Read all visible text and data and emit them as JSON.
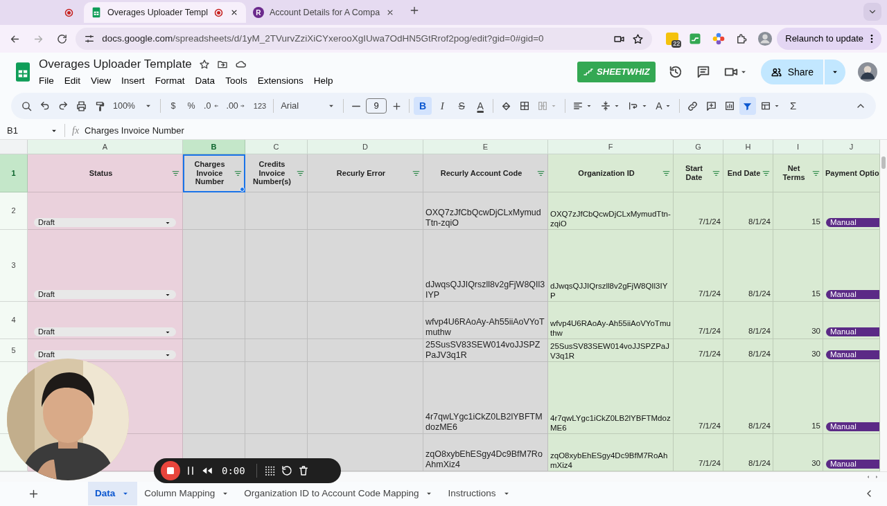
{
  "browser": {
    "tabs": [
      {
        "kind": "pinned",
        "recording": true,
        "selected": false
      },
      {
        "kind": "sheets",
        "title": "Overages Uploader Templ",
        "recording": true,
        "selected": true
      },
      {
        "kind": "letter",
        "favicon": "R",
        "title": "Account Details for A Compa",
        "recording": false,
        "selected": false
      }
    ],
    "url_host": "docs.google.com",
    "url_path": "/spreadsheets/d/1yM_2TVurvZziXiCYxerooXgIUwa7OdHN5GtRrof2pog/edit?gid=0#gid=0",
    "extension_badge": "22",
    "relaunch": "Relaunch to update"
  },
  "doc": {
    "title": "Overages Uploader Template",
    "menus": [
      "File",
      "Edit",
      "View",
      "Insert",
      "Format",
      "Data",
      "Tools",
      "Extensions",
      "Help"
    ],
    "addon_logo": "SHEETWHIZ",
    "share": "Share"
  },
  "toolbar": {
    "zoom": "100%",
    "currency": "$",
    "percent": "%",
    "decimal_decrease": ".0",
    "decimal_increase": ".00",
    "more_formats": "123",
    "font": "Arial",
    "font_size": "9",
    "bold": {
      "label": "B",
      "on": true
    },
    "italic": {
      "label": "I",
      "on": false
    },
    "strikethrough": {
      "label": "S",
      "on": false
    },
    "text_color": "A",
    "text_rotation": "A",
    "filter_on": true,
    "functions": "Σ"
  },
  "formula_bar": {
    "cell": "B1",
    "fx": "fx",
    "value": "Charges Invoice Number"
  },
  "sheet": {
    "header_row": {
      "number": "1",
      "selected": true
    },
    "columns": [
      {
        "letter": "A",
        "header": "Status",
        "kind": "status",
        "color": "#ead1dc",
        "selected": false
      },
      {
        "letter": "B",
        "header": "Charges Invoice Number",
        "kind": "empty",
        "color": "#d9d9d9",
        "selected": true
      },
      {
        "letter": "C",
        "header": "Credits Invoice Number(s)",
        "kind": "empty",
        "color": "#d9d9d9",
        "selected": false
      },
      {
        "letter": "D",
        "header": "Recurly Error",
        "kind": "empty",
        "color": "#d9d9d9",
        "selected": false
      },
      {
        "letter": "E",
        "header": "Recurly Account Code",
        "kind": "code",
        "color": "#d9d9d9",
        "selected": false
      },
      {
        "letter": "F",
        "header": "Organization ID",
        "kind": "id",
        "color": "#d9ead3",
        "selected": false
      },
      {
        "letter": "G",
        "header": "Start Date",
        "kind": "number",
        "color": "#d9ead3",
        "selected": false
      },
      {
        "letter": "H",
        "header": "End Date",
        "kind": "number",
        "color": "#d9ead3",
        "selected": false
      },
      {
        "letter": "I",
        "header": "Net Terms",
        "kind": "number",
        "color": "#d9ead3",
        "selected": false
      },
      {
        "letter": "J",
        "header": "Payment Optio",
        "kind": "chip",
        "color": "#d9ead3",
        "selected": false
      }
    ],
    "rows": [
      {
        "number": "2",
        "status": "Draft",
        "account_code": "OXQ7zJfCbQcwDjCLxMymudTtn-zqiO",
        "organization_id": "OXQ7zJfCbQcwDjCLxMymudTtn-zqiO",
        "start_date": "7/1/24",
        "end_date": "8/1/24",
        "net_terms": "15",
        "payment_option": "Manual"
      },
      {
        "number": "3",
        "status": "Draft",
        "account_code": "dJwqsQJJIQrszll8v2gFjW8QIl3IYP",
        "organization_id": "dJwqsQJJIQrszll8v2gFjW8QIl3IYP",
        "start_date": "7/1/24",
        "end_date": "8/1/24",
        "net_terms": "15",
        "payment_option": "Manual"
      },
      {
        "number": "4",
        "status": "Draft",
        "account_code": "wfvp4U6RAoAy-Ah55iiAoVYoTmuthw",
        "organization_id": "wfvp4U6RAoAy-Ah55iiAoVYoTmuthw",
        "start_date": "7/1/24",
        "end_date": "8/1/24",
        "net_terms": "30",
        "payment_option": "Manual"
      },
      {
        "number": "5",
        "status": "Draft",
        "account_code": "25SusSV83SEW014voJJSPZPaJV3q1R",
        "organization_id": "25SusSV83SEW014voJJSPZPaJV3q1R",
        "start_date": "7/1/24",
        "end_date": "8/1/24",
        "net_terms": "30",
        "payment_option": "Manual"
      },
      {
        "account_code": "4r7qwLYgc1iCkZ0LB2lYBFTMdozME6",
        "organization_id": "4r7qwLYgc1iCkZ0LB2lYBFTMdozME6",
        "start_date": "7/1/24",
        "end_date": "8/1/24",
        "net_terms": "15",
        "payment_option": "Manual"
      },
      {
        "account_code": "zqO8xybEhESgy4Dc9BfM7RoAhmXiz4",
        "organization_id": "zqO8xybEhESgy4Dc9BfM7RoAhmXiz4",
        "start_date": "7/1/24",
        "end_date": "8/1/24",
        "net_terms": "30",
        "payment_option": "Manual"
      }
    ]
  },
  "recorder": {
    "timer": "0:00"
  },
  "sheet_tabs": [
    {
      "label": "Data",
      "selected": true
    },
    {
      "label": "Column Mapping",
      "selected": false
    },
    {
      "label": "Organization ID to Account Code Mapping",
      "selected": false
    },
    {
      "label": "Instructions",
      "selected": false
    }
  ]
}
